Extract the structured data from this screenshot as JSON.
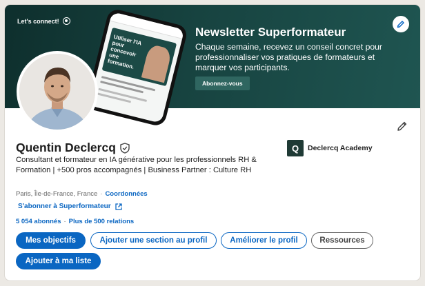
{
  "banner": {
    "lets_connect": "Let's connect!",
    "title": "Newsletter Superformateur",
    "description": "Chaque semaine, recevez un conseil concret pour professionnaliser vos pratiques de formateurs et marquer vos participants.",
    "button": "Abonnez-vous",
    "phone_text": "Utiliser l'IA pour concevoir une formation."
  },
  "profile": {
    "name": "Quentin Declercq",
    "headline": "Consultant et formateur en IA générative pour les professionnels RH & Formation | +500 pros accompagnés | Business Partner : Culture RH",
    "location": "Paris, Île-de-France, France",
    "separator": "·",
    "contact_link": "Coordonnées",
    "subscribe_link": "S'abonner à Superformateur",
    "followers": "5 054 abonnés",
    "connections": "Plus de 500 relations"
  },
  "company": {
    "logo_letter": "Q",
    "name": "Declercq Academy"
  },
  "actions": {
    "primary": "Mes objectifs",
    "add_section": "Ajouter une section au profil",
    "improve": "Améliorer le profil",
    "resources": "Ressources",
    "add_list": "Ajouter à ma liste"
  },
  "colors": {
    "accent": "#0a66c2",
    "banner": "#174340"
  }
}
